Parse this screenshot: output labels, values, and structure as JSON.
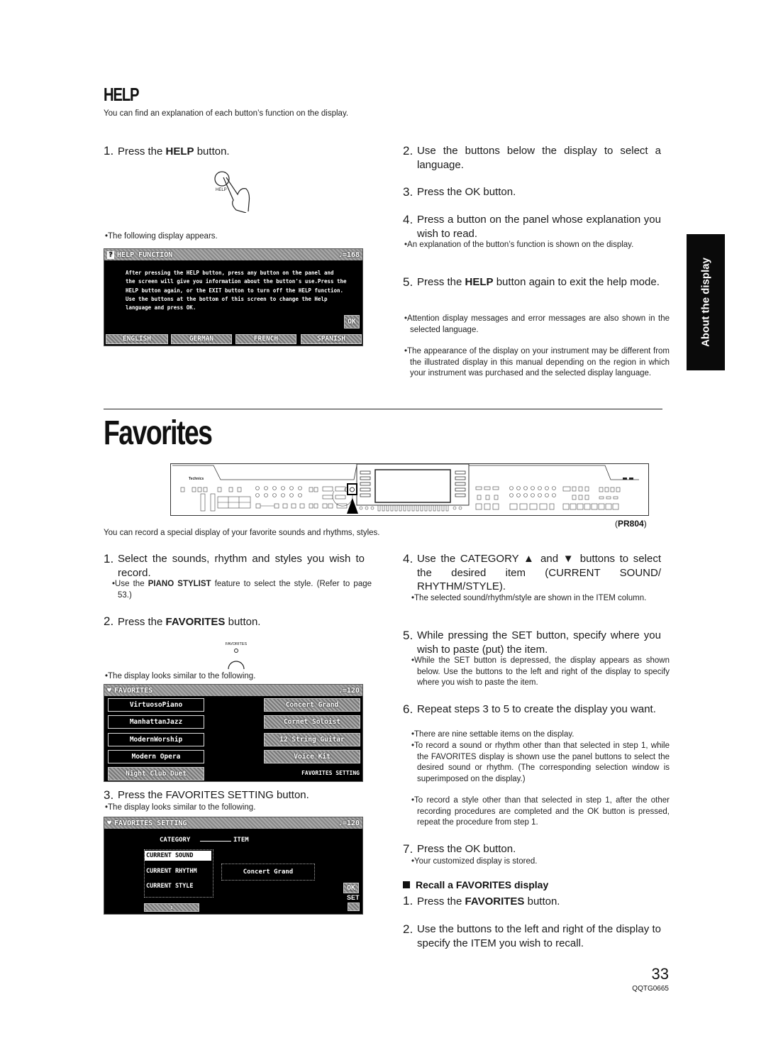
{
  "help": {
    "heading": "HELP",
    "intro": "You can find an explanation of each button’s function on the display.",
    "step1": {
      "num": "1.",
      "pre": "Press the ",
      "bold": "HELP",
      "post": " button."
    },
    "hand_label": "HELP",
    "note1": "The following display appears.",
    "screen": {
      "title": "HELP FUNCTION",
      "tempo": "♩=168",
      "body": [
        "After pressing the HELP button, press any button on the panel and",
        "the screen will give you information about the button's use.Press the",
        "HELP button again, or the EXIT button to turn off the HELP function.",
        "Use the buttons at the bottom of this screen to change the Help",
        "language and press OK."
      ],
      "ok": "OK",
      "languages": [
        "ENGLISH",
        "GERMAN",
        "FRENCH",
        "SPANISH"
      ]
    },
    "step2": {
      "num": "2.",
      "text": "Use the buttons below the display to select a language."
    },
    "step3": {
      "num": "3.",
      "text": "Press the OK button."
    },
    "step4": {
      "num": "4.",
      "text": "Press a button on the panel whose explanation you wish to read."
    },
    "step4_note": "An explanation of the button’s function is shown on the display.",
    "step5": {
      "num": "5.",
      "pre": "Press the ",
      "bold": "HELP",
      "post": " button again to exit the help mode."
    },
    "step5_note1": "Attention display messages and error messages are also shown in the selected language.",
    "step5_note2": "The appearance of the display on your instrument may be different from the illustrated display in this manual depending on the region in which your instrument was purchased and the selected display language."
  },
  "side_tab": "About the display",
  "favorites": {
    "heading": "Favorites",
    "model": "PR804",
    "intro": "You can record a special display of your favorite sounds and rhythms, styles.",
    "step1": {
      "num": "1.",
      "text": "Select the sounds, rhythm and styles you wish to record."
    },
    "step1_note": {
      "pre": "Use the ",
      "bold": "PIANO STYLIST",
      "post": " feature to select the style. (Refer to page 53.)"
    },
    "step2": {
      "num": "2.",
      "pre": "Press the ",
      "bold": "FAVORITES",
      "post": " button."
    },
    "button_label": "FAVORITES",
    "step2_note": "The display looks similar to the following.",
    "screen1": {
      "title": "FAVORITES",
      "tempo": "♩=120",
      "left": [
        "VirtuosoPiano",
        "ManhattanJazz",
        "ModernWorship",
        "Modern Opera",
        "Night Club Duet"
      ],
      "right": [
        "Concert Grand",
        "Cornet Soloist",
        "12 String Guitar",
        "Voice Kit"
      ],
      "setting": "FAVORITES SETTING"
    },
    "step3": {
      "num": "3.",
      "text": "Press the FAVORITES SETTING button."
    },
    "step3_note": "The display looks similar to the following.",
    "screen2": {
      "title": "FAVORITES SETTING",
      "tempo": "♩=120",
      "category": "CATEGORY",
      "item": "ITEM",
      "categories": [
        "CURRENT SOUND",
        "CURRENT RHYTHM",
        "CURRENT STYLE"
      ],
      "selected_item": "Concert Grand",
      "ok": "OK",
      "set": "SET"
    },
    "step4": {
      "num": "4.",
      "text": "Use the CATEGORY ▲ and ▼ buttons to select the desired item (CURRENT SOUND/ RHYTHM/STYLE)."
    },
    "step4_note": "The selected sound/rhythm/style are shown in the ITEM column.",
    "step5": {
      "num": "5.",
      "text": "While pressing the SET button, specify where you wish to paste (put) the item."
    },
    "step5_note": "While the SET button is depressed, the display appears as shown below. Use the buttons to the left and right of the display to specify where you wish to paste the item.",
    "step6": {
      "num": "6.",
      "text": "Repeat steps 3 to 5 to create the display you want."
    },
    "step6_notes": [
      "There are nine settable items on the display.",
      "To record a sound or rhythm other than that selected in step 1, while the FAVORITES display is shown use the panel buttons to select the desired sound or rhythm. (The corresponding selection window is superimposed on the display.)",
      "To record a style other than that selected in step 1, after the other recording procedures are completed and the OK button is pressed, repeat the procedure from step 1."
    ],
    "step7": {
      "num": "7.",
      "text": "Press the OK button."
    },
    "step7_note": "Your customized display is stored.",
    "recall_heading": "Recall a FAVORITES display",
    "recall1": {
      "num": "1.",
      "pre": "Press the ",
      "bold": "FAVORITES",
      "post": " button."
    },
    "recall2": {
      "num": "2.",
      "text": "Use the buttons to the left and right of the display to specify the ITEM you wish to recall."
    }
  },
  "footer": {
    "page": "33",
    "code": "QQTG0665"
  }
}
